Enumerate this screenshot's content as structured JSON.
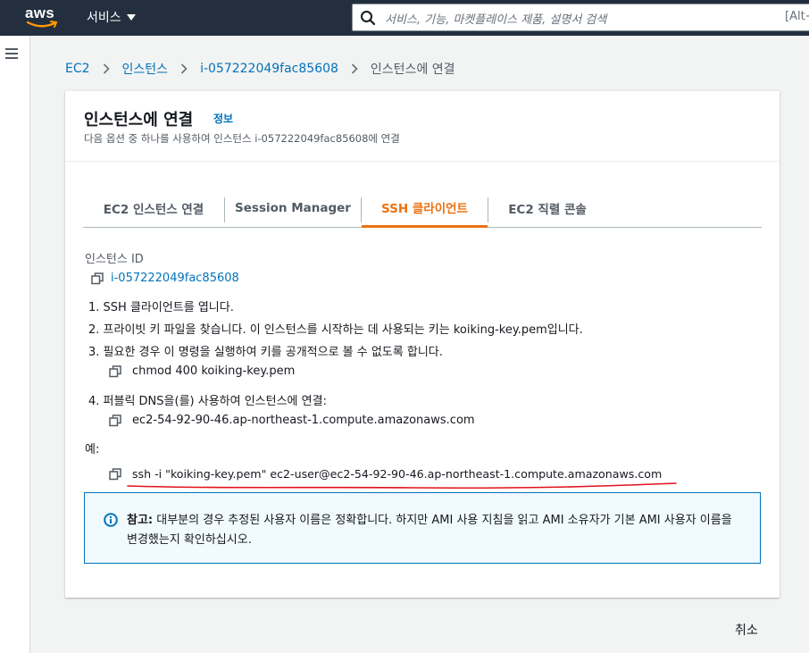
{
  "nav": {
    "logo": "aws",
    "services": "서비스",
    "search_placeholder": "서비스, 기능, 마켓플레이스 제품, 설명서 검색",
    "search_shortcut": "[Alt+S]"
  },
  "breadcrumb": {
    "ec2": "EC2",
    "instances": "인스턴스",
    "instance": "i-057222049fac85608",
    "current": "인스턴스에 연결"
  },
  "page": {
    "title": "인스턴스에 연결",
    "info": "정보",
    "subtitle": "다음 옵션 중 하나를 사용하여 인스턴스 i-057222049fac85608에 연결"
  },
  "tabs": [
    "EC2 인스턴스 연결",
    "Session Manager",
    "SSH 클라이언트",
    "EC2 직렬 콘솔"
  ],
  "active_tab": "SSH 클라이언트",
  "ssh": {
    "instance_id_label": "인스턴스 ID",
    "instance_id": "i-057222049fac85608",
    "step1": "1. SSH 클라이언트를 엽니다.",
    "step2": "2. 프라이빗 키 파일을 찾습니다. 이 인스턴스를 시작하는 데 사용되는 키는 koiking-key.pem입니다.",
    "step3": "3. 필요한 경우 이 명령을 실행하여 키를 공개적으로 볼 수 없도록 합니다.",
    "chmod": "chmod 400 koiking-key.pem",
    "step4": "4. 퍼블릭 DNS을(를) 사용하여 인스턴스에 연결:",
    "dns": "ec2-54-92-90-46.ap-northeast-1.compute.amazonaws.com",
    "example_label": "예:",
    "example_cmd": "ssh -i \"koiking-key.pem\" ec2-user@ec2-54-92-90-46.ap-northeast-1.compute.amazonaws.com"
  },
  "note": {
    "label": "참고:",
    "text": " 대부분의 경우 추정된 사용자 이름은 정확합니다. 하지만 AMI 사용 지침을 읽고 AMI 소유자가 기본 AMI 사용자 이름을 변경했는지 확인하십시오."
  },
  "cancel": "취소",
  "colors": {
    "nav_bg": "#232f3e",
    "link": "#0073bb",
    "active_tab": "#ec7211",
    "annotation": "#e0121b"
  }
}
